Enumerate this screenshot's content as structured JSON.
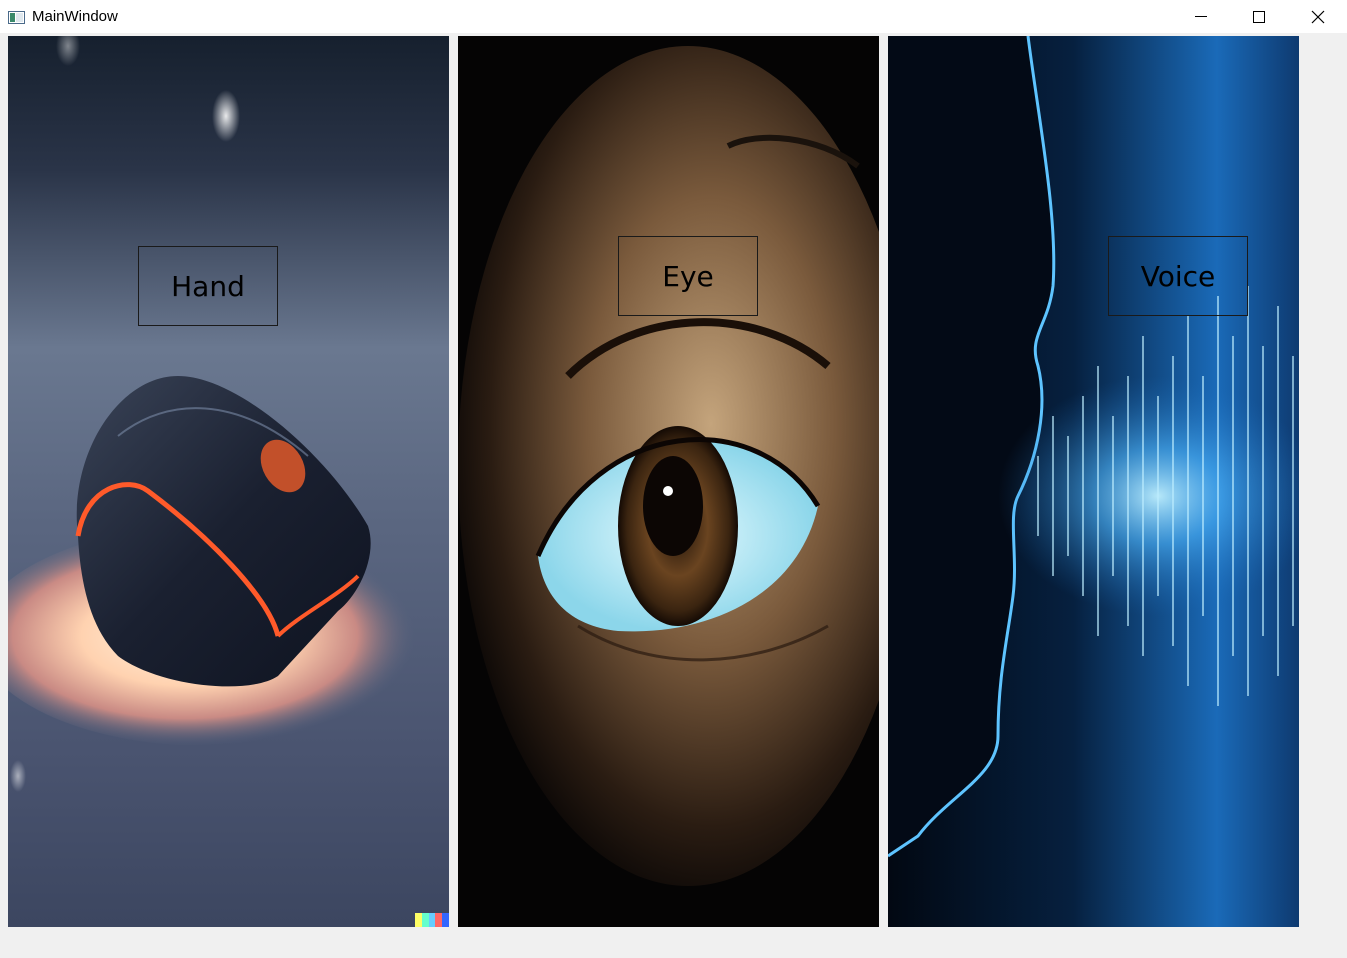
{
  "window": {
    "title": "MainWindow",
    "icon": "app-window-icon",
    "controls": {
      "minimize_icon": "minimize-icon",
      "maximize_icon": "maximize-icon",
      "close_icon": "close-icon"
    }
  },
  "panels": [
    {
      "label": "Hand",
      "image": "computer-mouse-image"
    },
    {
      "label": "Eye",
      "image": "human-eye-image"
    },
    {
      "label": "Voice",
      "image": "voice-waveform-image"
    }
  ],
  "colors": {
    "window_bg": "#f0f0f0",
    "titlebar_bg": "#ffffff",
    "hand_bg": "#3e4a66",
    "eye_bg": "#0a0706",
    "voice_bg": "#0a2a55",
    "voice_accent": "#4fb8ff"
  }
}
